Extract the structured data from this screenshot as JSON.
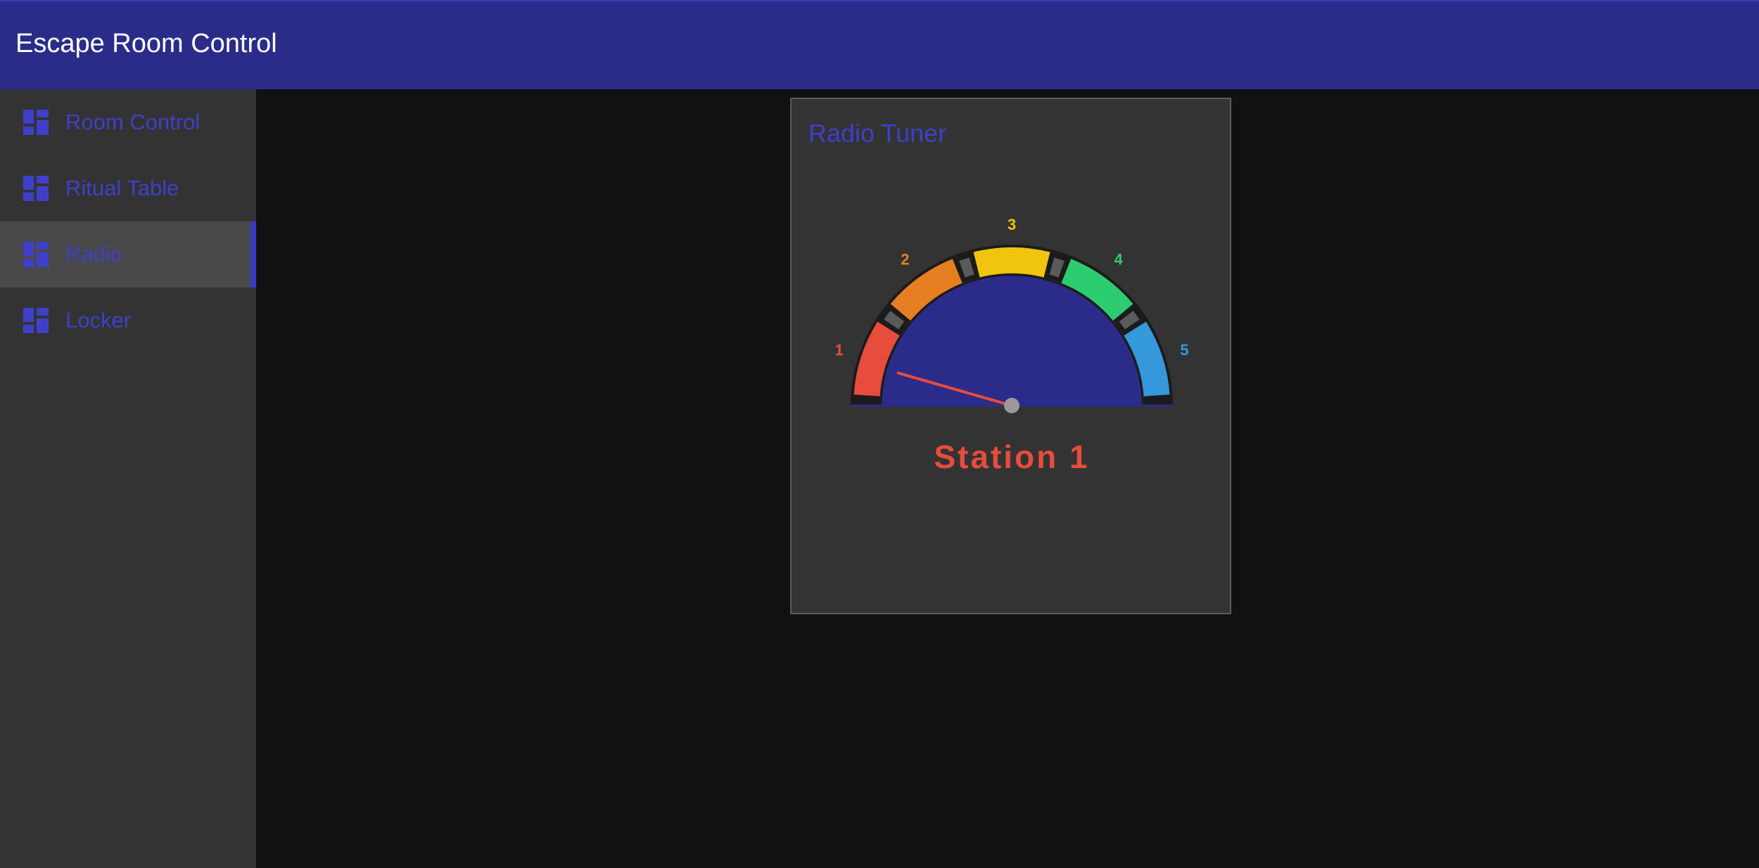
{
  "app": {
    "title": "Escape Room Control"
  },
  "sidebar": {
    "items": [
      {
        "label": "Room Control",
        "icon": "dashboard-icon",
        "active": false
      },
      {
        "label": "Ritual Table",
        "icon": "dashboard-icon",
        "active": false
      },
      {
        "label": "Radio",
        "icon": "dashboard-icon",
        "active": true
      },
      {
        "label": "Locker",
        "icon": "dashboard-icon",
        "active": false
      }
    ]
  },
  "card": {
    "title": "Radio Tuner"
  },
  "tuner": {
    "stations": [
      {
        "label": "1",
        "color": "#e74c3c"
      },
      {
        "label": "2",
        "color": "#e67e22"
      },
      {
        "label": "3",
        "color": "#f1c40f"
      },
      {
        "label": "4",
        "color": "#2ecc71"
      },
      {
        "label": "5",
        "color": "#3498db"
      }
    ],
    "current_station": 1,
    "station_text": "Station 1",
    "dial_color": "#2b2c8a"
  },
  "colors": {
    "header_bg": "#2b2c8a",
    "accent": "#3a3bc4",
    "nav_label": "#3f40c8"
  }
}
